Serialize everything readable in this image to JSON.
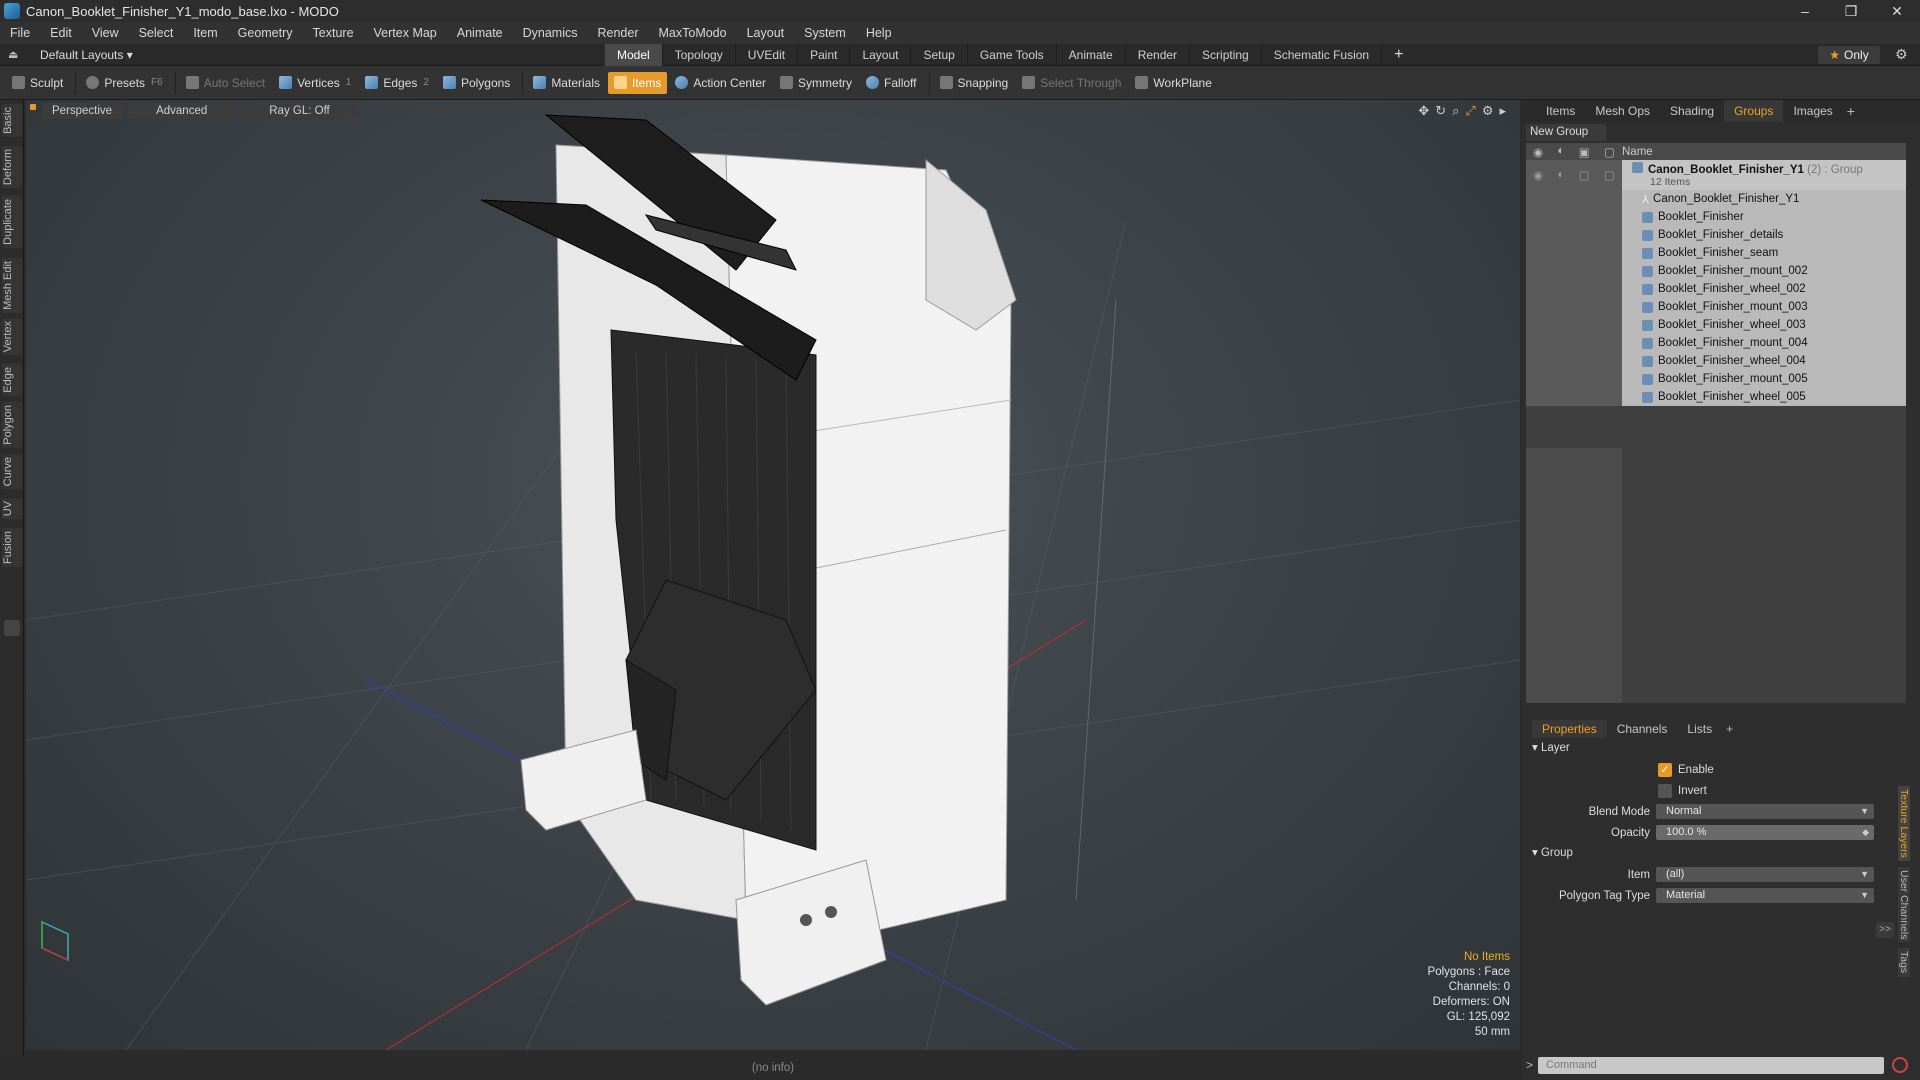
{
  "window": {
    "title": "Canon_Booklet_Finisher_Y1_modo_base.lxo - MODO",
    "controls": [
      "–",
      "❐",
      "✕"
    ]
  },
  "menu": [
    "File",
    "Edit",
    "View",
    "Select",
    "Item",
    "Geometry",
    "Texture",
    "Vertex Map",
    "Animate",
    "Dynamics",
    "Render",
    "MaxToModo",
    "Layout",
    "System",
    "Help"
  ],
  "layoutbar": {
    "layouts": "Default Layouts ▾",
    "tabs": [
      "Model",
      "Topology",
      "UVEdit",
      "Paint",
      "Layout",
      "Setup",
      "Game Tools",
      "Animate",
      "Render",
      "Scripting",
      "Schematic Fusion"
    ],
    "active_tab": "Model",
    "plus": "+",
    "only": "Only"
  },
  "toolbar": {
    "sculpt": "Sculpt",
    "presets": "Presets",
    "presets_key": "F6",
    "auto_select": "Auto Select",
    "vertices": "Vertices",
    "vertices_count": "1",
    "edges": "Edges",
    "edges_count": "2",
    "polygons": "Polygons",
    "materials": "Materials",
    "items": "Items",
    "action_center": "Action Center",
    "symmetry": "Symmetry",
    "falloff": "Falloff",
    "snapping": "Snapping",
    "select_through": "Select Through",
    "workplane": "WorkPlane"
  },
  "left_tabs": [
    "Basic",
    "Deform",
    "Duplicate",
    "Mesh Edit",
    "Vertex",
    "Edge",
    "Polygon",
    "Curve",
    "UV",
    "Fusion"
  ],
  "viewport": {
    "perspective": "Perspective",
    "advanced": "Advanced",
    "raygl": "Ray GL: Off",
    "info": {
      "no_items": "No Items",
      "polygons": "Polygons : Face",
      "channels": "Channels: 0",
      "deformers": "Deformers: ON",
      "gl": "GL: 125,092",
      "scale": "50 mm"
    },
    "status": "(no info)"
  },
  "right_panel": {
    "tabs": [
      "Items",
      "Mesh Ops",
      "Shading",
      "Groups",
      "Images"
    ],
    "active_tab": "Groups",
    "new_group": "New Group",
    "list_header": "Name",
    "root": {
      "name": "Canon_Booklet_Finisher_Y1",
      "meta": " (2) : Group",
      "count": "12 Items"
    },
    "items": [
      "Canon_Booklet_Finisher_Y1",
      "Booklet_Finisher",
      "Booklet_Finisher_details",
      "Booklet_Finisher_seam",
      "Booklet_Finisher_mount_002",
      "Booklet_Finisher_wheel_002",
      "Booklet_Finisher_mount_003",
      "Booklet_Finisher_wheel_003",
      "Booklet_Finisher_mount_004",
      "Booklet_Finisher_wheel_004",
      "Booklet_Finisher_mount_005",
      "Booklet_Finisher_wheel_005"
    ],
    "props_tabs": [
      "Properties",
      "Channels",
      "Lists"
    ],
    "props_active": "Properties",
    "layer_section": "Layer",
    "enable": "Enable",
    "invert": "Invert",
    "blend_mode_label": "Blend Mode",
    "blend_mode": "Normal",
    "opacity_label": "Opacity",
    "opacity": "100.0 %",
    "group_section": "Group",
    "item_label": "Item",
    "item_value": "(all)",
    "ptag_label": "Polygon Tag Type",
    "ptag_value": "Material",
    "side_tabs": [
      "Texture Layers",
      "User Channels",
      "Tags"
    ],
    "command_placeholder": "Command"
  },
  "colors": {
    "accent": "#e89a22",
    "viewport_bg": "#3a4045"
  }
}
